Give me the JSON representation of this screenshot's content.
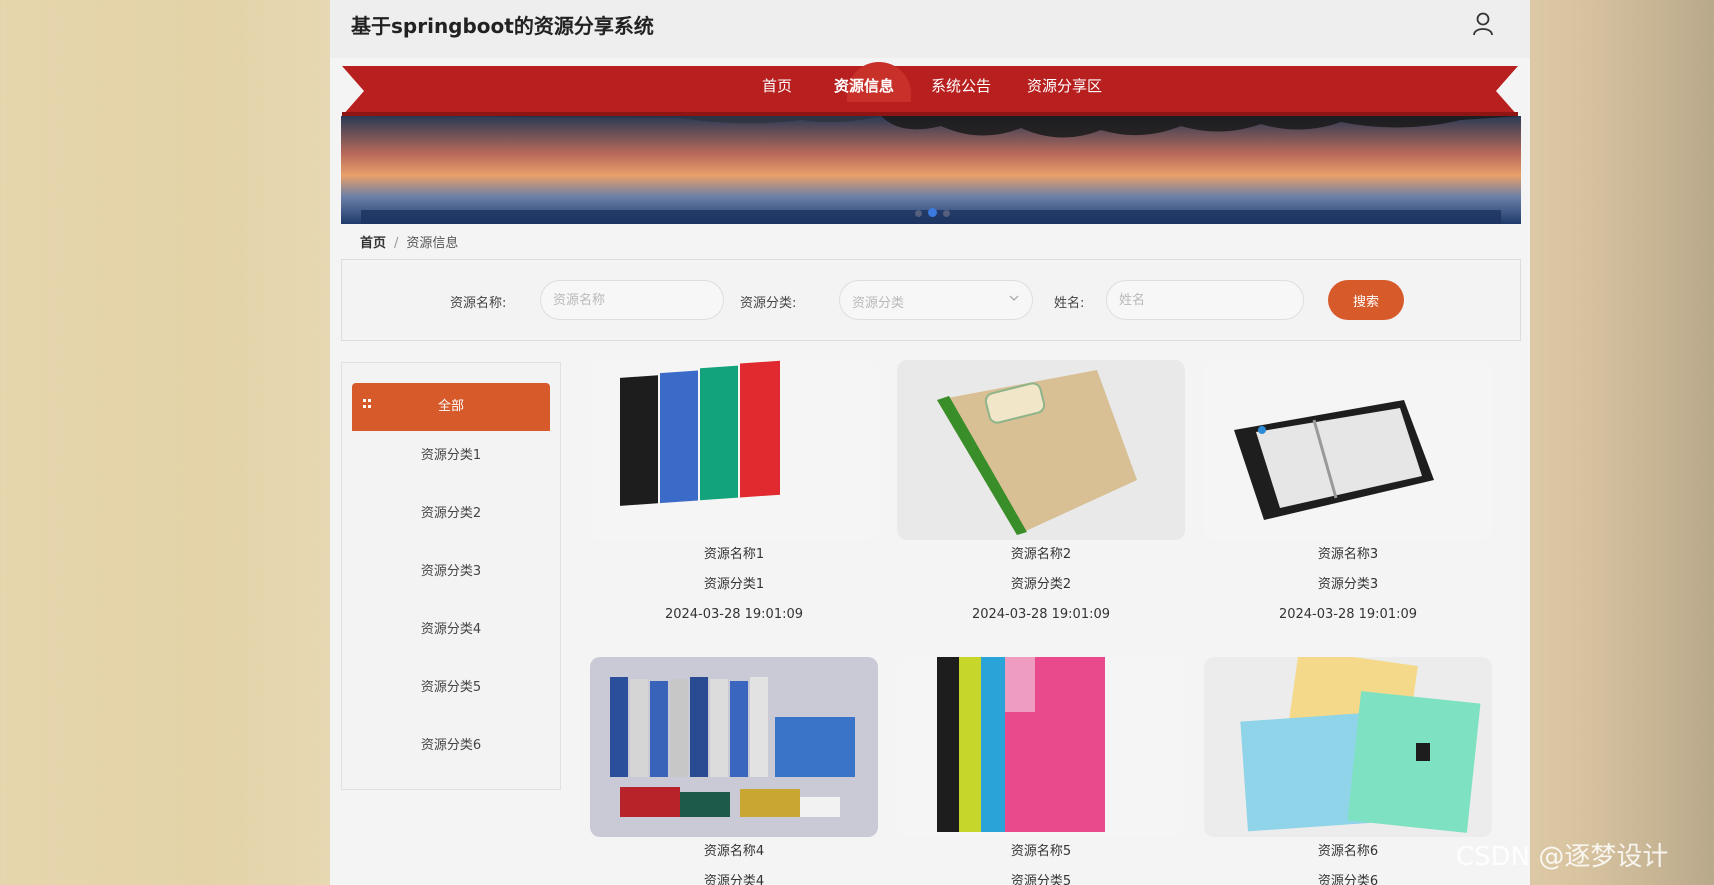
{
  "header": {
    "title": "基于springboot的资源分享系统"
  },
  "nav": [
    {
      "label": "首页"
    },
    {
      "label": "资源信息"
    },
    {
      "label": "系统公告"
    },
    {
      "label": "资源分享区"
    }
  ],
  "colors": {
    "ribbon": "#b8201f",
    "accent": "#d75a2a",
    "active_nav": "#c8312a"
  },
  "breadcrumb": {
    "home": "首页",
    "sep": "/",
    "current": "资源信息"
  },
  "search": {
    "name_label": "资源名称:",
    "name_placeholder": "资源名称",
    "category_label": "资源分类:",
    "category_placeholder": "资源分类",
    "person_label": "姓名:",
    "person_placeholder": "姓名",
    "button": "搜索"
  },
  "sidebar": {
    "all": "全部",
    "items": [
      "资源分类1",
      "资源分类2",
      "资源分类3",
      "资源分类4",
      "资源分类5",
      "资源分类6"
    ]
  },
  "cards": [
    {
      "name": "资源名称1",
      "category": "资源分类1",
      "time": "2024-03-28 19:01:09"
    },
    {
      "name": "资源名称2",
      "category": "资源分类2",
      "time": "2024-03-28 19:01:09"
    },
    {
      "name": "资源名称3",
      "category": "资源分类3",
      "time": "2024-03-28 19:01:09"
    },
    {
      "name": "资源名称4",
      "category": "资源分类4"
    },
    {
      "name": "资源名称5",
      "category": "资源分类5"
    },
    {
      "name": "资源名称6",
      "category": "资源分类6"
    }
  ],
  "watermark": "CSDN @逐梦设计"
}
